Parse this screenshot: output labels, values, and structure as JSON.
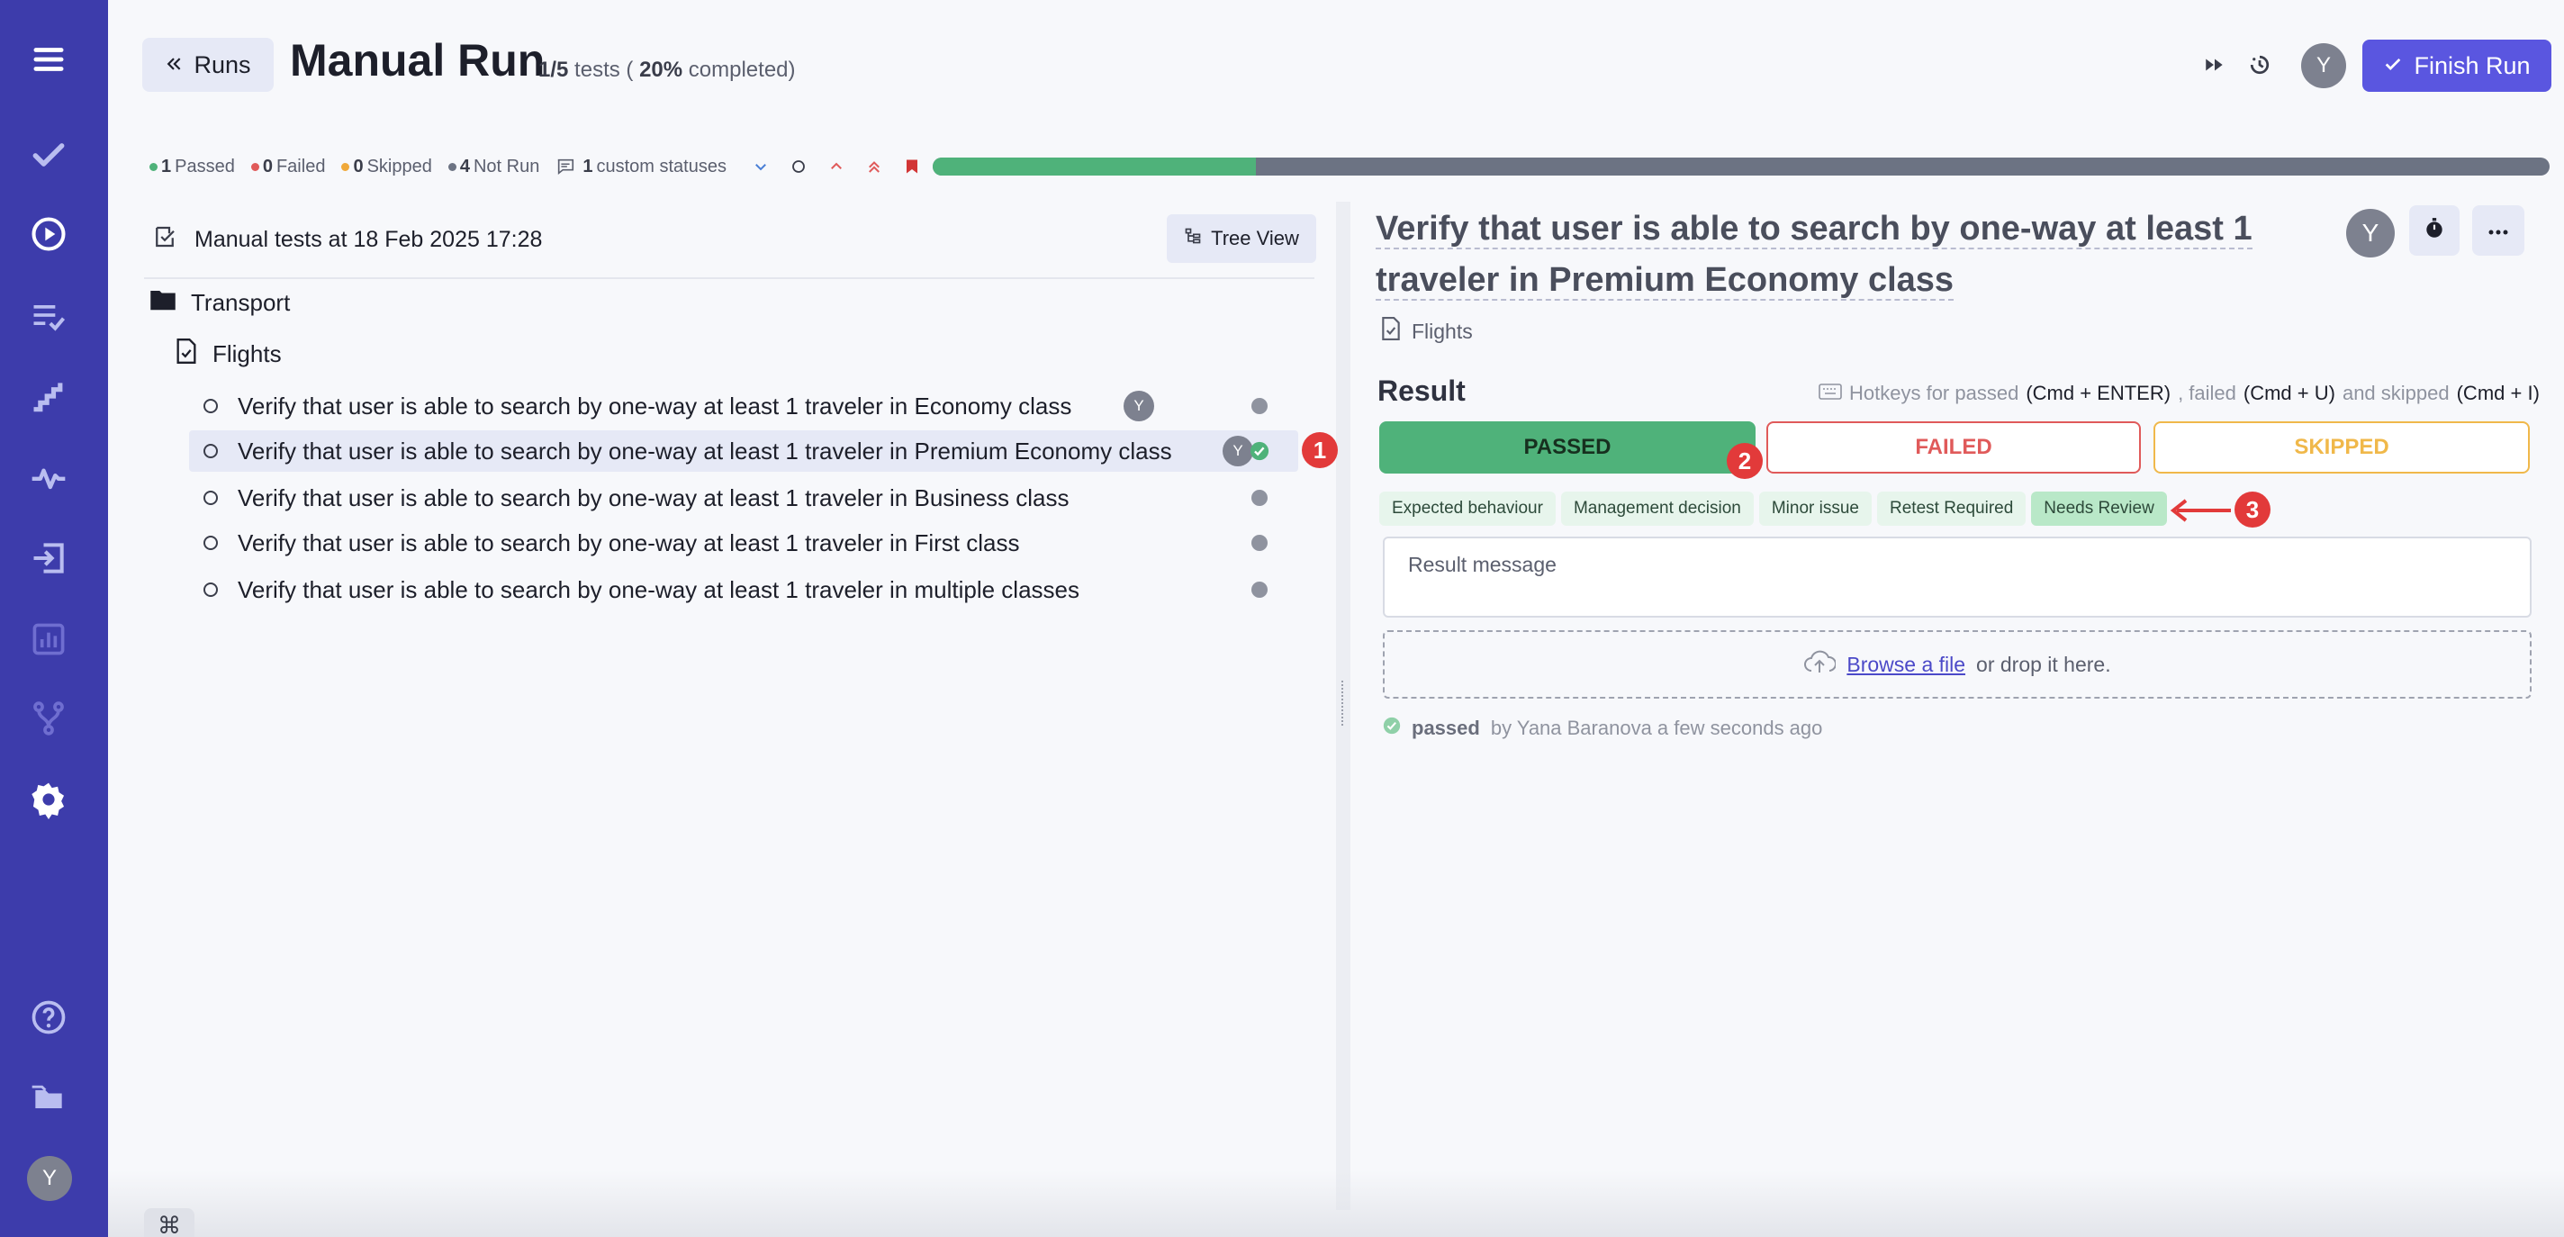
{
  "sidebar": {
    "items": [
      {
        "icon": "menu-icon"
      },
      {
        "icon": "checkmark-icon"
      },
      {
        "icon": "play-circle-icon"
      },
      {
        "icon": "checklist-icon"
      },
      {
        "icon": "steps-icon"
      },
      {
        "icon": "pulse-icon"
      },
      {
        "icon": "import-icon"
      },
      {
        "icon": "bar-chart-icon"
      },
      {
        "icon": "branch-icon"
      },
      {
        "icon": "gear-icon"
      },
      {
        "icon": "help-icon"
      },
      {
        "icon": "folders-icon"
      }
    ],
    "user_initial": "Y"
  },
  "header": {
    "back_label": "Runs",
    "title": "Manual Run",
    "progress_count": "1/5",
    "progress_tests": "tests (",
    "progress_percent": "20%",
    "progress_completed": "completed)",
    "avatar_initial": "Y",
    "finish_label": "Finish Run",
    "accent": "#5a56e0"
  },
  "stats": {
    "passed_count": "1",
    "passed_label": "Passed",
    "failed_count": "0",
    "failed_label": "Failed",
    "skipped_count": "0",
    "skipped_label": "Skipped",
    "notrun_count": "4",
    "notrun_label": "Not Run",
    "custom_count": "1",
    "custom_label": "custom statuses",
    "progress_fraction": 0.2,
    "colors": {
      "passed": "#4fb27a",
      "failed": "#e05a5a",
      "skipped": "#f0a93a",
      "notrun": "#6c7383"
    }
  },
  "tree": {
    "suite_title": "Manual tests at 18 Feb 2025 17:28",
    "view_label": "Tree View",
    "folder": "Transport",
    "file": "Flights",
    "tests": [
      {
        "title": "Verify that user is able to search by one-way at least 1 traveler in Economy class",
        "assignee": "Y",
        "status": "not-run"
      },
      {
        "title": "Verify that user is able to search by one-way at least 1 traveler in Premium Economy class",
        "assignee": "Y",
        "status": "passed",
        "selected": true
      },
      {
        "title": "Verify that user is able to search by one-way at least 1 traveler in Business class",
        "assignee": "",
        "status": "not-run"
      },
      {
        "title": "Verify that user is able to search by one-way at least 1 traveler in First class",
        "assignee": "",
        "status": "not-run"
      },
      {
        "title": "Verify that user is able to search by one-way at least 1 traveler in multiple classes",
        "assignee": "",
        "status": "not-run"
      }
    ]
  },
  "detail": {
    "title_line1": "Verify that user is able to search by one-way at least 1",
    "title_line2": "traveler in Premium Economy class",
    "suite": "Flights",
    "assignee": "Y",
    "result_label": "Result",
    "hotkeys_prefix": "Hotkeys for passed",
    "hotkey_passed": "(Cmd + ENTER)",
    "hotkeys_failed": ", failed",
    "hotkey_failed": "(Cmd + U)",
    "hotkeys_skipped": "and skipped",
    "hotkey_skipped": "(Cmd + I)",
    "passed_btn": "PASSED",
    "failed_btn": "FAILED",
    "skipped_btn": "SKIPPED",
    "tags": [
      "Expected behaviour",
      "Management decision",
      "Minor issue",
      "Retest Required",
      "Needs Review"
    ],
    "result_placeholder": "Result message",
    "browse_link": "Browse a file",
    "drop_text": "or drop it here.",
    "passed_status": "passed",
    "passed_by": "by Yana Baranova a few seconds ago"
  },
  "annotations": [
    "1",
    "2",
    "3"
  ],
  "footer": {
    "cmd_glyph": "⌘"
  }
}
